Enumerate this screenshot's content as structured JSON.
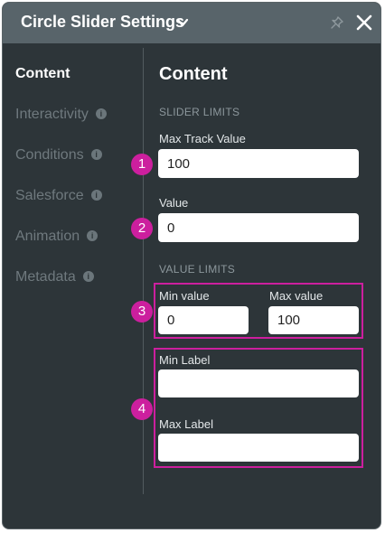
{
  "header": {
    "title": "Circle Slider Settings",
    "chevron_icon": "chevron-down-icon",
    "pin_icon": "pin-icon",
    "close_icon": "close-icon"
  },
  "sidebar": {
    "items": [
      {
        "label": "Content",
        "active": true,
        "info": false
      },
      {
        "label": "Interactivity",
        "active": false,
        "info": true
      },
      {
        "label": "Conditions",
        "active": false,
        "info": true
      },
      {
        "label": "Salesforce",
        "active": false,
        "info": true
      },
      {
        "label": "Animation",
        "active": false,
        "info": true
      },
      {
        "label": "Metadata",
        "active": false,
        "info": true
      }
    ],
    "info_glyph": "i"
  },
  "main": {
    "title": "Content",
    "slider_limits": {
      "heading": "SLIDER LIMITS",
      "max_track_label": "Max Track Value",
      "max_track_value": "100",
      "value_label": "Value",
      "value_value": "0"
    },
    "value_limits": {
      "heading": "VALUE LIMITS",
      "min_value_label": "Min value",
      "min_value": "0",
      "max_value_label": "Max value",
      "max_value": "100",
      "min_label_label": "Min Label",
      "min_label_value": "",
      "max_label_label": "Max Label",
      "max_label_value": ""
    }
  },
  "annotations": {
    "badges": [
      "1",
      "2",
      "3",
      "4"
    ],
    "color": "#cc1f9e"
  }
}
